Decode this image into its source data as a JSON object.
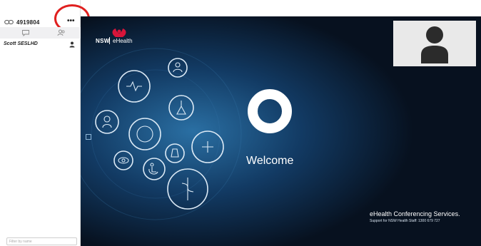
{
  "sidebar": {
    "conference_id": "4919804",
    "more_label": "•••",
    "participants": [
      {
        "name": "Scott SESLHD"
      }
    ],
    "filter_placeholder": "Filter by name"
  },
  "video": {
    "brand_nsw": "NSW",
    "brand_ehealth": "eHealth",
    "welcome": "Welcome",
    "footer_title": "eHealth Conferencing Services.",
    "footer_subtitle": "Support for NSW Health Staff: 1300 679 727"
  },
  "icons": {
    "conference": "link-icon",
    "more": "ellipsis-icon",
    "chat": "chat-bubble-icon",
    "participants": "people-icon",
    "participant": "person-icon",
    "self_view": "avatar-silhouette-icon"
  },
  "colors": {
    "highlight": "#e0201f",
    "stage_background": "#0b1a2e",
    "nsw_red": "#d7153a"
  }
}
